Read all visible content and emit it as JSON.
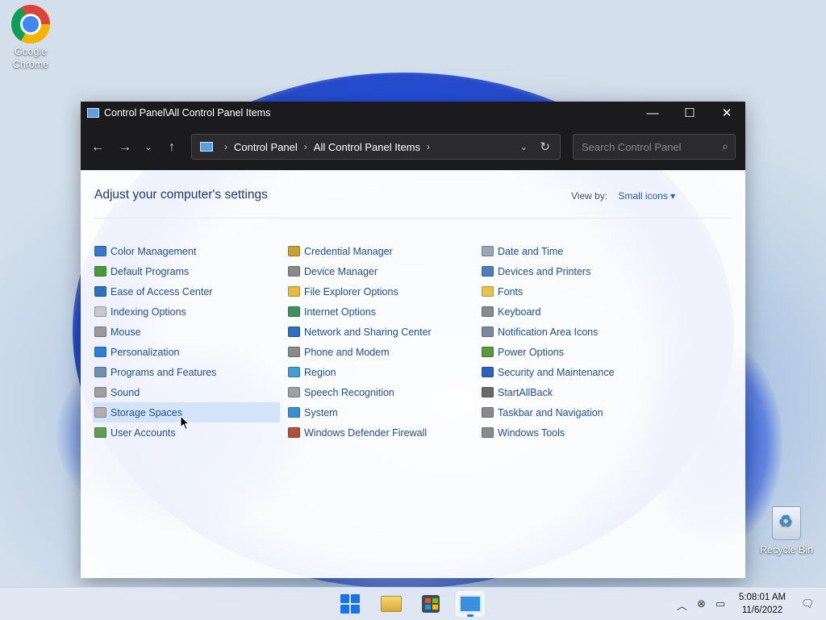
{
  "desktop": {
    "icons": [
      {
        "label": "Google Chrome",
        "icon": "chrome-icon"
      },
      {
        "label": "Recycle Bin",
        "icon": "recycle-bin-icon"
      }
    ]
  },
  "window": {
    "title": "Control Panel\\All Control Panel Items",
    "buttons": {
      "minimize": "—",
      "maximize": "☐",
      "close": "✕"
    }
  },
  "nav": {
    "back": "←",
    "forward": "→",
    "recent": "⌄",
    "up": "↑",
    "breadcrumb": [
      "Control Panel",
      "All Control Panel Items"
    ],
    "search_placeholder": "Search Control Panel"
  },
  "content": {
    "heading": "Adjust your computer's settings",
    "view_by_label": "View by:",
    "view_by_value": "Small icons ▾",
    "columns": [
      [
        {
          "label": "Color Management",
          "icon": "color-management-icon",
          "color": "#3a78c8"
        },
        {
          "label": "Default Programs",
          "icon": "default-programs-icon",
          "color": "#4a9a3a"
        },
        {
          "label": "Ease of Access Center",
          "icon": "ease-of-access-icon",
          "color": "#2f6fbf"
        },
        {
          "label": "Indexing Options",
          "icon": "indexing-options-icon",
          "color": "#c9c9c9"
        },
        {
          "label": "Mouse",
          "icon": "mouse-icon",
          "color": "#9a9a9a"
        },
        {
          "label": "Personalization",
          "icon": "personalization-icon",
          "color": "#2d7fd6"
        },
        {
          "label": "Programs and Features",
          "icon": "programs-features-icon",
          "color": "#6f8fb3"
        },
        {
          "label": "Sound",
          "icon": "sound-icon",
          "color": "#a0a0a0"
        },
        {
          "label": "Storage Spaces",
          "icon": "storage-spaces-icon",
          "color": "#b0b0b0"
        },
        {
          "label": "User Accounts",
          "icon": "user-accounts-icon",
          "color": "#5f9f4f"
        }
      ],
      [
        {
          "label": "Credential Manager",
          "icon": "credential-manager-icon",
          "color": "#c8a230"
        },
        {
          "label": "Device Manager",
          "icon": "device-manager-icon",
          "color": "#8a8a8a"
        },
        {
          "label": "File Explorer Options",
          "icon": "file-explorer-options-icon",
          "color": "#e7bb3f"
        },
        {
          "label": "Internet Options",
          "icon": "internet-options-icon",
          "color": "#3f8f5f"
        },
        {
          "label": "Network and Sharing Center",
          "icon": "network-sharing-icon",
          "color": "#2f6fbf"
        },
        {
          "label": "Phone and Modem",
          "icon": "phone-modem-icon",
          "color": "#8a8a8a"
        },
        {
          "label": "Region",
          "icon": "region-icon",
          "color": "#3f9fd0"
        },
        {
          "label": "Speech Recognition",
          "icon": "speech-recognition-icon",
          "color": "#a0a0a0"
        },
        {
          "label": "System",
          "icon": "system-icon",
          "color": "#3a8fcf"
        },
        {
          "label": "Windows Defender Firewall",
          "icon": "firewall-icon",
          "color": "#b0523a"
        }
      ],
      [
        {
          "label": "Date and Time",
          "icon": "date-time-icon",
          "color": "#9aa6b6"
        },
        {
          "label": "Devices and Printers",
          "icon": "devices-printers-icon",
          "color": "#4a7fb8"
        },
        {
          "label": "Fonts",
          "icon": "fonts-icon",
          "color": "#e8c34a"
        },
        {
          "label": "Keyboard",
          "icon": "keyboard-icon",
          "color": "#8a8a8a"
        },
        {
          "label": "Notification Area Icons",
          "icon": "notification-area-icon",
          "color": "#7a8aa0"
        },
        {
          "label": "Power Options",
          "icon": "power-options-icon",
          "color": "#5a9a3a"
        },
        {
          "label": "Security and Maintenance",
          "icon": "security-maintenance-icon",
          "color": "#2f5fbf"
        },
        {
          "label": "StartAllBack",
          "icon": "startallback-icon",
          "color": "#6a6a6a"
        },
        {
          "label": "Taskbar and Navigation",
          "icon": "taskbar-navigation-icon",
          "color": "#8a8a8a"
        },
        {
          "label": "Windows Tools",
          "icon": "windows-tools-icon",
          "color": "#8a8a8a"
        }
      ]
    ]
  },
  "taskbar": {
    "apps": [
      "start-icon",
      "file-explorer-icon",
      "microsoft-store-icon",
      "control-panel-icon"
    ],
    "time": "5:08:01 AM",
    "date": "11/6/2022"
  }
}
